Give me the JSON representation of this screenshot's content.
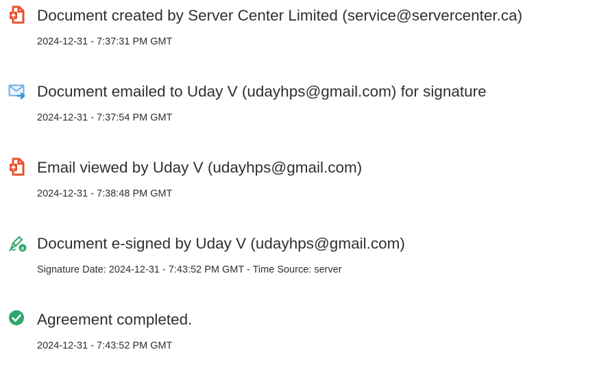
{
  "events": [
    {
      "icon": "document-created-icon",
      "title": "Document created by Server Center Limited (service@servercenter.ca)",
      "time": "2024-12-31 - 7:37:31 PM GMT"
    },
    {
      "icon": "email-sent-icon",
      "title": "Document emailed to Uday V (udayhps@gmail.com) for signature",
      "time": "2024-12-31 - 7:37:54 PM GMT"
    },
    {
      "icon": "email-viewed-icon",
      "title": "Email viewed by Uday V (udayhps@gmail.com)",
      "time": "2024-12-31 - 7:38:48 PM GMT"
    },
    {
      "icon": "e-sign-pen-icon",
      "title": "Document e-signed by Uday V (udayhps@gmail.com)",
      "time": "Signature Date: 2024-12-31 - 7:43:52 PM GMT - Time Source: server"
    },
    {
      "icon": "check-circle-icon",
      "title": "Agreement completed.",
      "time": "2024-12-31 - 7:43:52 PM GMT"
    }
  ],
  "colors": {
    "acrobat_red": "#e8502f",
    "mail_blue": "#2e8fd8",
    "pen_green": "#2ea76a",
    "check_green": "#2ea76a",
    "text": "#2f2f2f"
  }
}
